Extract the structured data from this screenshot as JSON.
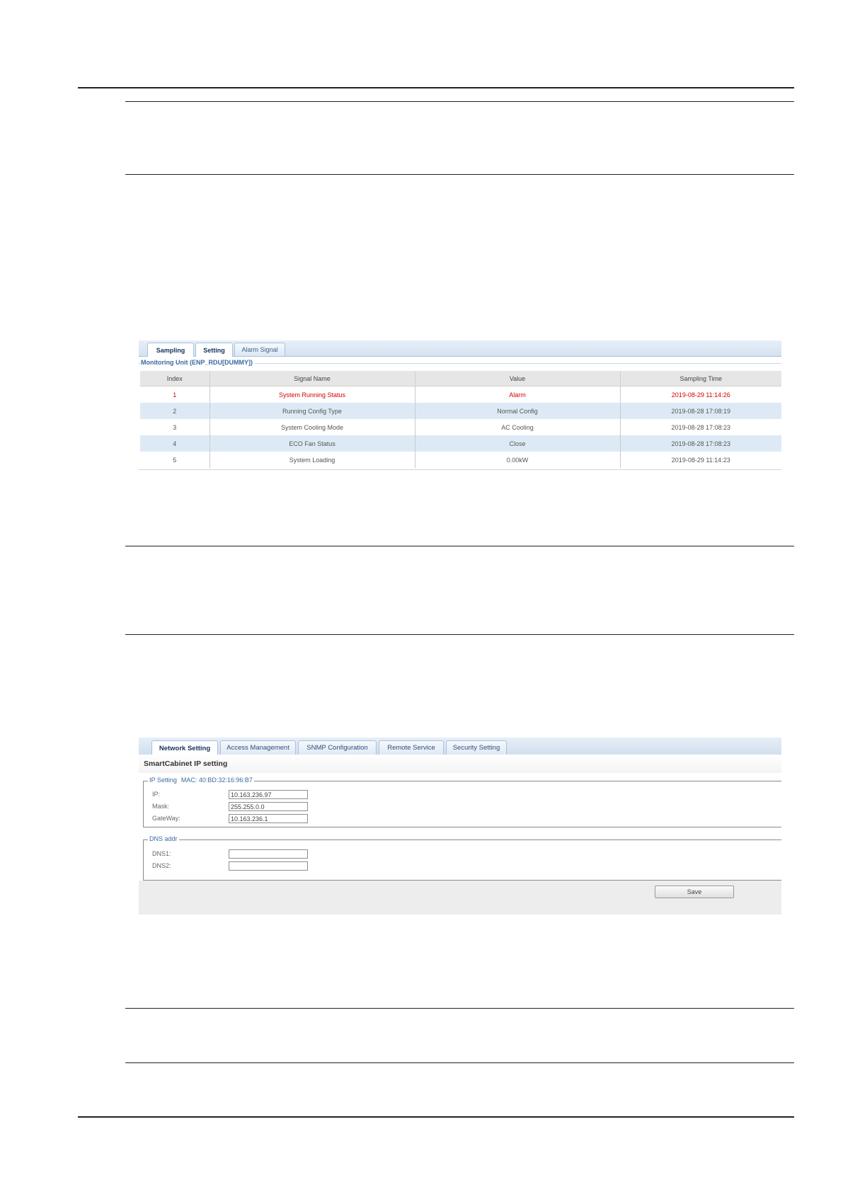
{
  "screenshot1": {
    "tabs": [
      {
        "label": "Sampling",
        "active": true
      },
      {
        "label": "Setting",
        "active": true
      },
      {
        "label": "Alarm Signal",
        "active": false
      }
    ],
    "section_title": "Monitoring Unit (ENP_RDU[DUMMY])",
    "columns": [
      "Index",
      "Signal Name",
      "Value",
      "Sampling Time"
    ],
    "rows": [
      {
        "index": "1",
        "name": "System Running Status",
        "value": "Alarm",
        "time": "2019-08-29 11:14:26",
        "alarm": true
      },
      {
        "index": "2",
        "name": "Running Config Type",
        "value": "Normal Config",
        "time": "2019-08-28 17:08:19",
        "alarm": false
      },
      {
        "index": "3",
        "name": "System Cooling Mode",
        "value": "AC Cooling",
        "time": "2019-08-28 17:08:23",
        "alarm": false
      },
      {
        "index": "4",
        "name": "ECO Fan Status",
        "value": "Close",
        "time": "2019-08-28 17:08:23",
        "alarm": false
      },
      {
        "index": "5",
        "name": "System Loading",
        "value": "0.00kW",
        "time": "2019-08-29 11:14:23",
        "alarm": false
      }
    ]
  },
  "screenshot2": {
    "tabs": [
      {
        "label": "Network Setting",
        "active": true
      },
      {
        "label": "Access Management",
        "active": false
      },
      {
        "label": "SNMP Configuration",
        "active": false
      },
      {
        "label": "Remote Service",
        "active": false
      },
      {
        "label": "Security Setting",
        "active": false
      }
    ],
    "page_title": "SmartCabinet IP setting",
    "ip_setting": {
      "legend": "IP Setting",
      "mac": "MAC: 40:BD:32:16:96:B7",
      "fields": [
        {
          "label": "IP:",
          "value": "10.163.236.97"
        },
        {
          "label": "Mask:",
          "value": "255.255.0.0"
        },
        {
          "label": "GateWay:",
          "value": "10.163.236.1"
        }
      ]
    },
    "dns": {
      "legend": "DNS addr",
      "fields": [
        {
          "label": "DNS1:",
          "value": ""
        },
        {
          "label": "DNS2:",
          "value": ""
        }
      ]
    },
    "save_label": "Save"
  },
  "colors": {
    "alarm": "#d40000",
    "tab_border": "#a9c1dc",
    "row_alt": "#ddeaf6"
  }
}
